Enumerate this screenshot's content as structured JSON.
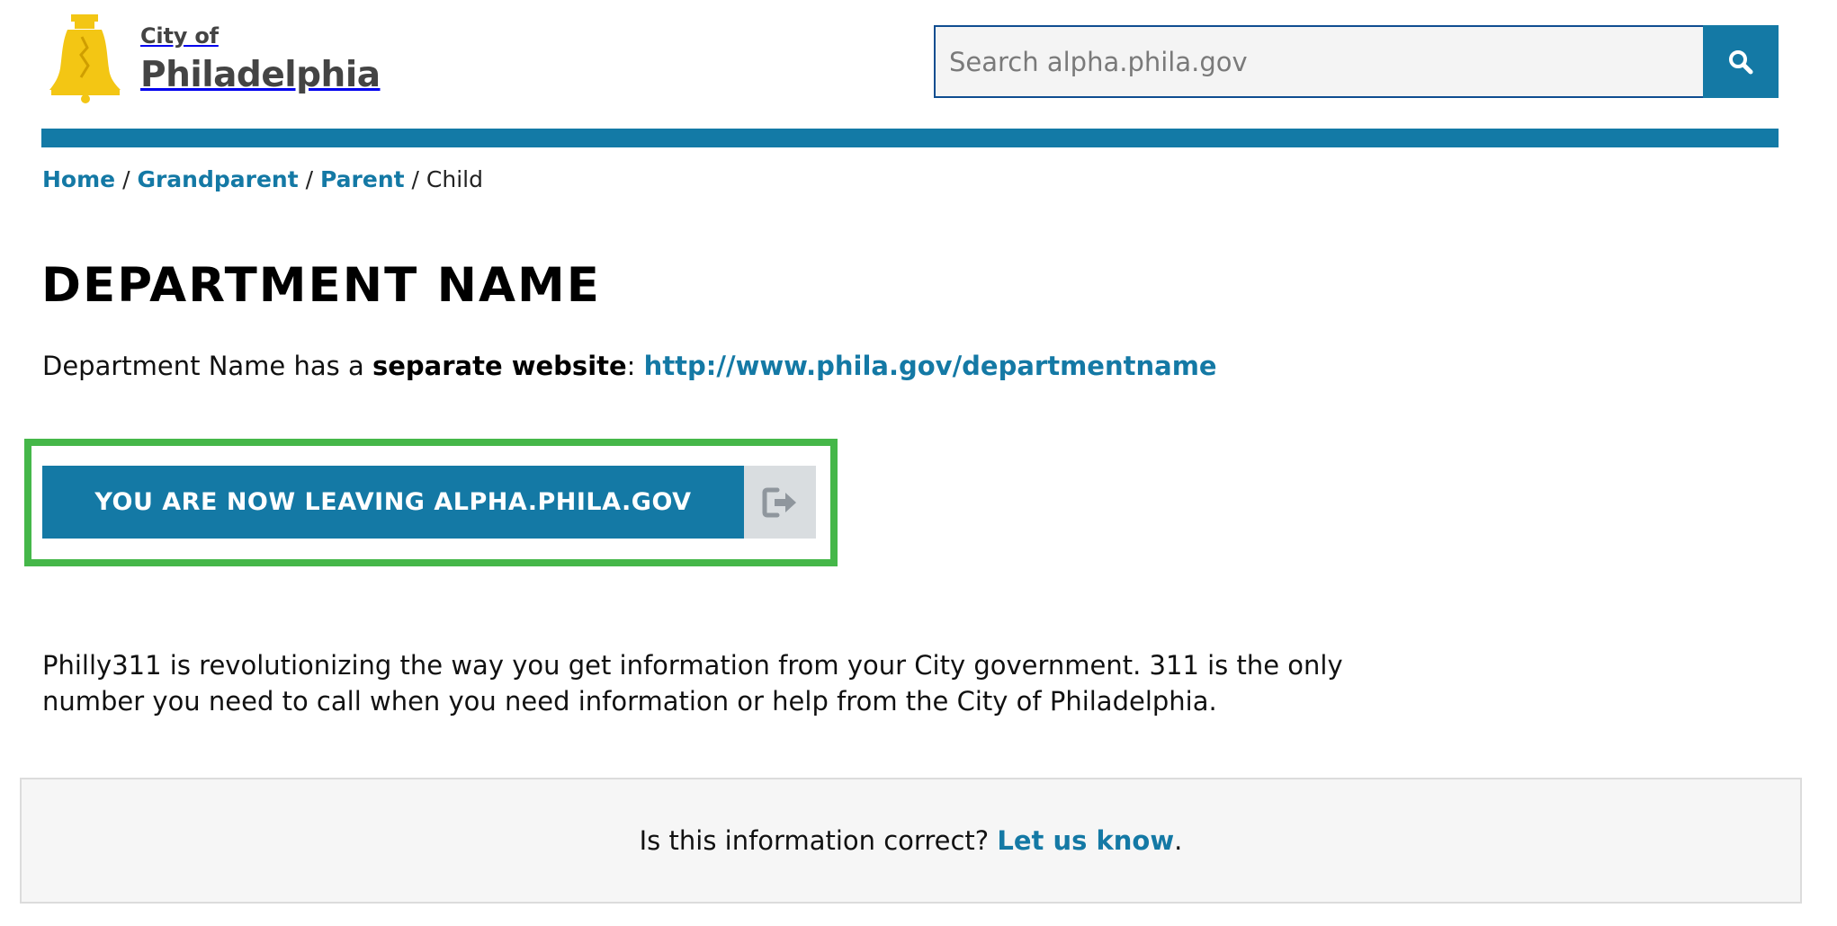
{
  "header": {
    "logo": {
      "small_text": "City of",
      "big_text": "Philadelphia",
      "icon": "liberty-bell-icon"
    },
    "search": {
      "placeholder": "Search alpha.phila.gov",
      "button_icon": "search-icon"
    }
  },
  "breadcrumb": {
    "items": [
      "Home",
      "Grandparent",
      "Parent",
      "Child"
    ],
    "separator": "/"
  },
  "main": {
    "title": "DEPARTMENT NAME",
    "website_line": {
      "prefix": "Department Name has a ",
      "emphasis": "separate website",
      "colon": ": ",
      "link": "http://www.phila.gov/departmentname"
    },
    "leave_button": {
      "label": "YOU ARE NOW LEAVING ALPHA.PHILA.GOV",
      "icon": "external-link-icon"
    },
    "description": "Philly311 is revolutionizing the way you get information from your City government. 311 is the only number you need to call when you need information or help from the City of Philadelphia."
  },
  "feedback": {
    "question": "Is this information correct? ",
    "link": "Let us know",
    "suffix": "."
  },
  "colors": {
    "primary_blue": "#1479a5",
    "highlight_green": "#45b749",
    "logo_yellow": "#f3c614",
    "icon_gray": "#8f969d"
  }
}
